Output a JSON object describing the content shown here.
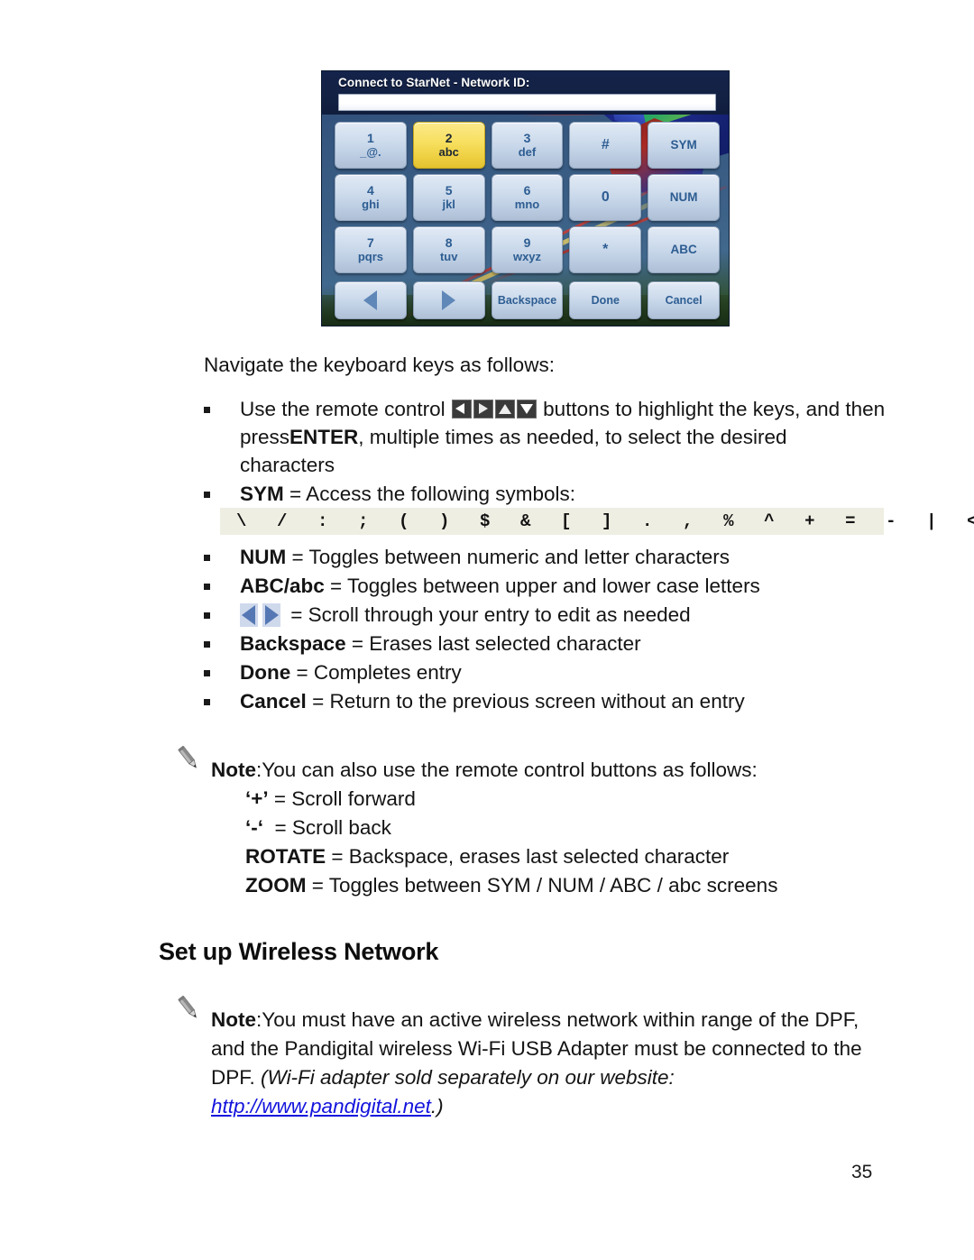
{
  "keypad": {
    "title": "Connect to StarNet - Network ID:",
    "input_value": "",
    "keys": [
      {
        "num": "1",
        "sub": "_@."
      },
      {
        "num": "2",
        "sub": "abc",
        "highlight": true
      },
      {
        "num": "3",
        "sub": "def"
      },
      {
        "single": "#"
      },
      {
        "word": "SYM"
      },
      {
        "num": "4",
        "sub": "ghi"
      },
      {
        "num": "5",
        "sub": "jkl"
      },
      {
        "num": "6",
        "sub": "mno"
      },
      {
        "single": "0"
      },
      {
        "word": "NUM"
      },
      {
        "num": "7",
        "sub": "pqrs"
      },
      {
        "num": "8",
        "sub": "tuv"
      },
      {
        "num": "9",
        "sub": "wxyz"
      },
      {
        "single": "*"
      },
      {
        "word": "ABC"
      }
    ],
    "footer": [
      {
        "icon": "arrow-left-icon",
        "label": ""
      },
      {
        "icon": "arrow-right-icon",
        "label": ""
      },
      {
        "label": "Backspace"
      },
      {
        "label": "Done"
      },
      {
        "label": "Cancel"
      }
    ]
  },
  "body": {
    "lead": "Navigate the keyboard keys as follows:",
    "bullet_remote_1": "Use the remote control",
    "bullet_remote_2": "buttons to highlight the keys, and then press",
    "bullet_remote_enter": "ENTER",
    "bullet_remote_3": ", multiple times as needed, to select the desired characters",
    "bullet_sym_label": "SYM",
    "bullet_sym_text": "= Access the following symbols:",
    "symbols": "\\  /  :  ;  (  )  $  &  [  ]  .  ,  %  ^  +  =  -  |  <  >  {  }  !  ~",
    "bullet_num_label": "NUM",
    "bullet_num_text": "= Toggles between numeric and letter characters",
    "bullet_abc_label": "ABC/abc",
    "bullet_abc_text": "= Toggles between upper and lower case letters",
    "bullet_scroll_text": "= Scroll through your entry to edit as needed",
    "bullet_backspace_label": "Backspace",
    "bullet_backspace_text": "= Erases last selected character",
    "bullet_done_label": "Done",
    "bullet_done_text": "= Completes entry",
    "bullet_cancel_label": "Cancel",
    "bullet_cancel_text": "= Return to the previous screen without an entry"
  },
  "note1": {
    "label": "Note",
    "text": ":You can also use the remote control buttons as follows:",
    "lines": [
      "‘+’ = Scroll forward",
      "‘-‘  = Scroll back",
      "ROTATE = Backspace, erases last selected character",
      "ZOOM = Toggles between SYM / NUM / ABC / abc screens"
    ],
    "bold_prefixes": [
      "+",
      "-",
      "ROTATE",
      "ZOOM"
    ]
  },
  "heading": "Set up Wireless Network",
  "note2": {
    "label": "Note",
    "text": ":You must have an active wireless network within range of the DPF, and the Pandigital wireless Wi-Fi USB Adapter must be connected to the DPF.",
    "italic_text": "(Wi-Fi adapter sold separately on our website:",
    "link": "http://www.pandigital.net",
    "italic_tail": ".)"
  },
  "page_number": "35",
  "colors": {
    "key_face": "#cddbec",
    "key_text": "#2d5d92",
    "key_highlight": "#f7df5e",
    "header_bar": "#132144",
    "symbol_strip_bg": "#efeee2",
    "link": "#1313dd"
  }
}
